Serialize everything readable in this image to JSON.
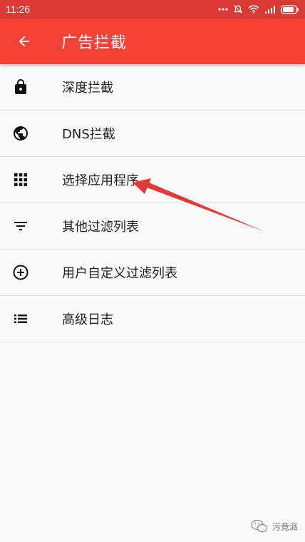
{
  "status_bar": {
    "time": "11:26",
    "icons": [
      "more-dots-icon",
      "mute-bell-icon",
      "wifi-icon",
      "signal-icon",
      "battery-icon"
    ]
  },
  "app_bar": {
    "back_icon": "back-arrow-icon",
    "title": "广告拦截",
    "color": "#f44336"
  },
  "menu": {
    "items": [
      {
        "label": "深度拦截",
        "icon": "lock-icon"
      },
      {
        "label": "DNS拦截",
        "icon": "globe-icon"
      },
      {
        "label": "选择应用程序",
        "icon": "grid-apps-icon"
      },
      {
        "label": "其他过滤列表",
        "icon": "filter-icon"
      },
      {
        "label": "用户自定义过滤列表",
        "icon": "add-circle-icon"
      },
      {
        "label": "高级日志",
        "icon": "list-icon"
      }
    ]
  },
  "annotation": {
    "arrow_color": "#e53935"
  },
  "watermark": {
    "text": "污竞派"
  }
}
